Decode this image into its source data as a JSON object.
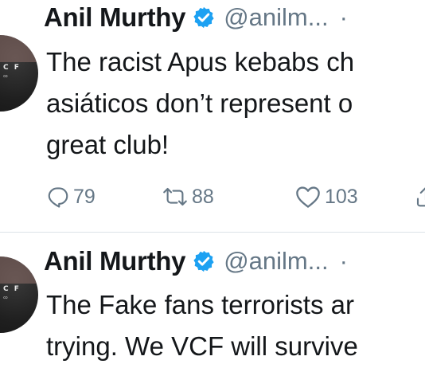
{
  "tweets": [
    {
      "display_name": "Anil Murthy",
      "handle": "@anilm...",
      "time_separator": "·",
      "avatar_text": "C F",
      "avatar_subtext": "∞",
      "text_lines": [
        "The racist Apus kebabs ch",
        "asiáticos don’t represent o",
        "great club!"
      ],
      "replies": "79",
      "retweets": "88",
      "likes": "103"
    },
    {
      "display_name": "Anil Murthy",
      "handle": "@anilm...",
      "time_separator": "·",
      "avatar_text": "C F",
      "avatar_subtext": "∞",
      "text_lines": [
        "The Fake fans terrorists ar",
        "trying. We VCF will survive"
      ]
    }
  ],
  "icons": {
    "verified": "verified-badge-icon",
    "reply": "reply-icon",
    "retweet": "retweet-icon",
    "like": "heart-icon",
    "share": "share-icon"
  },
  "colors": {
    "verified_blue": "#1da1f2",
    "text": "#14171a",
    "secondary": "#657786",
    "divider": "#dde3e8"
  }
}
